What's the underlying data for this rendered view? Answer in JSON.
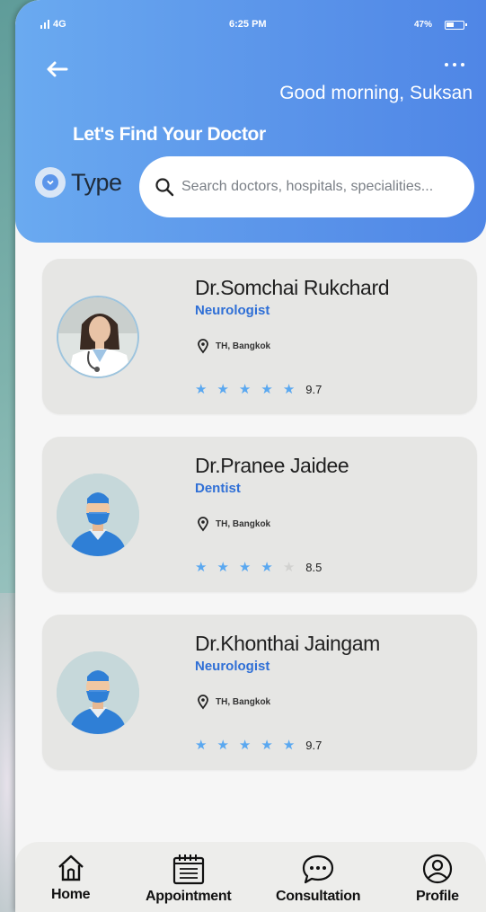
{
  "status_bar": {
    "network": "4G",
    "time": "6:25 PM",
    "battery": "47%"
  },
  "header": {
    "greeting": "Good morning, Suksan",
    "subtitle": "Let's Find Your Doctor",
    "type_filter_label": "Type",
    "search_placeholder": "Search doctors, hospitals, specialities...",
    "accent": "#5b95ea"
  },
  "doctors": [
    {
      "name": "Dr.Somchai Rukchard",
      "specialty": "Neurologist",
      "location": "TH, Bangkok",
      "rating": "9.7",
      "stars_filled": 5,
      "avatar": "female-doctor-photo"
    },
    {
      "name": "Dr.Pranee Jaidee",
      "specialty": "Dentist",
      "location": "TH, Bangkok",
      "rating": "8.5",
      "stars_filled": 4,
      "avatar": "surgeon-avatar"
    },
    {
      "name": "Dr.Khonthai Jaingam",
      "specialty": "Neurologist",
      "location": "TH, Bangkok",
      "rating": "9.7",
      "stars_filled": 5,
      "avatar": "surgeon-avatar"
    }
  ],
  "nav": [
    {
      "label": "Home",
      "icon": "home-icon"
    },
    {
      "label": "Appointment",
      "icon": "calendar-icon"
    },
    {
      "label": "Consultation",
      "icon": "chat-icon"
    },
    {
      "label": "Profile",
      "icon": "user-icon"
    }
  ],
  "colors": {
    "star_filled": "#5aa8f0",
    "star_empty": "#d2d2d0",
    "specialty": "#2f6fd6"
  }
}
